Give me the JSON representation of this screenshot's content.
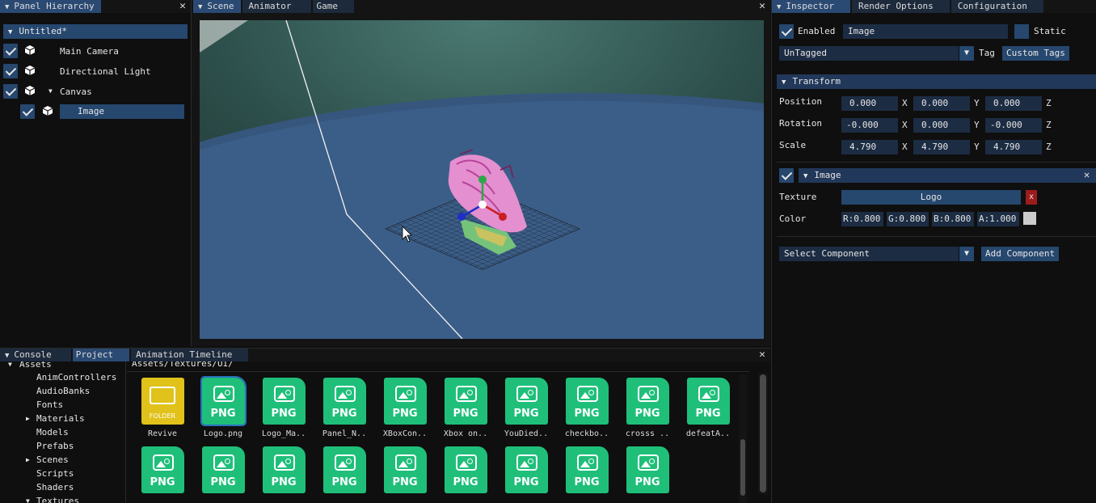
{
  "hierarchy": {
    "tab": "Panel Hierarchy",
    "root": "Untitled*",
    "items": [
      {
        "label": "Main Camera"
      },
      {
        "label": "Directional Light"
      },
      {
        "label": "Canvas"
      },
      {
        "label": "Image"
      }
    ]
  },
  "scene": {
    "tabs": [
      "Scene",
      "Animator",
      "Game"
    ]
  },
  "inspector": {
    "tabs": [
      "Inspector",
      "Render Options",
      "Configuration"
    ],
    "enabled_label": "Enabled",
    "name_value": "Image",
    "static_label": "Static",
    "tag_value": "UnTagged",
    "tag_label": "Tag",
    "custom_tags_label": "Custom Tags",
    "transform": {
      "title": "Transform",
      "rows": [
        {
          "label": "Position",
          "x": "0.000",
          "y": "0.000",
          "z": "0.000"
        },
        {
          "label": "Rotation",
          "x": "-0.000",
          "y": "0.000",
          "z": "-0.000"
        },
        {
          "label": "Scale",
          "x": "4.790",
          "y": "4.790",
          "z": "4.790"
        }
      ],
      "axis_x": "X",
      "axis_y": "Y",
      "axis_z": "Z"
    },
    "image_component": {
      "title": "Image",
      "texture_label": "Texture",
      "texture_value": "Logo",
      "remove_texture": "x",
      "color_label": "Color",
      "r": "R:0.800",
      "g": "G:0.800",
      "b": "B:0.800",
      "a": "A:1.000"
    },
    "select_component": "Select Component",
    "add_component": "Add Component"
  },
  "bottom": {
    "tabs": [
      "Console",
      "Project",
      "Animation Timeline"
    ],
    "path": "Assets/Textures/UI/",
    "tree_root": "Assets",
    "tree": [
      "AnimControllers",
      "AudioBanks",
      "Fonts",
      "Materials",
      "Models",
      "Prefabs",
      "Scenes",
      "Scripts",
      "Shaders",
      "Textures"
    ],
    "folder_label": "FOLDER",
    "png_label": "PNG",
    "files_row1": [
      "Revive",
      "Logo.png",
      "Logo_Ma..",
      "Panel_N..",
      "XBoxCon..",
      "Xbox on..",
      "YouDied..",
      "checkbo..",
      "crosss ..",
      "defeatA.."
    ]
  }
}
